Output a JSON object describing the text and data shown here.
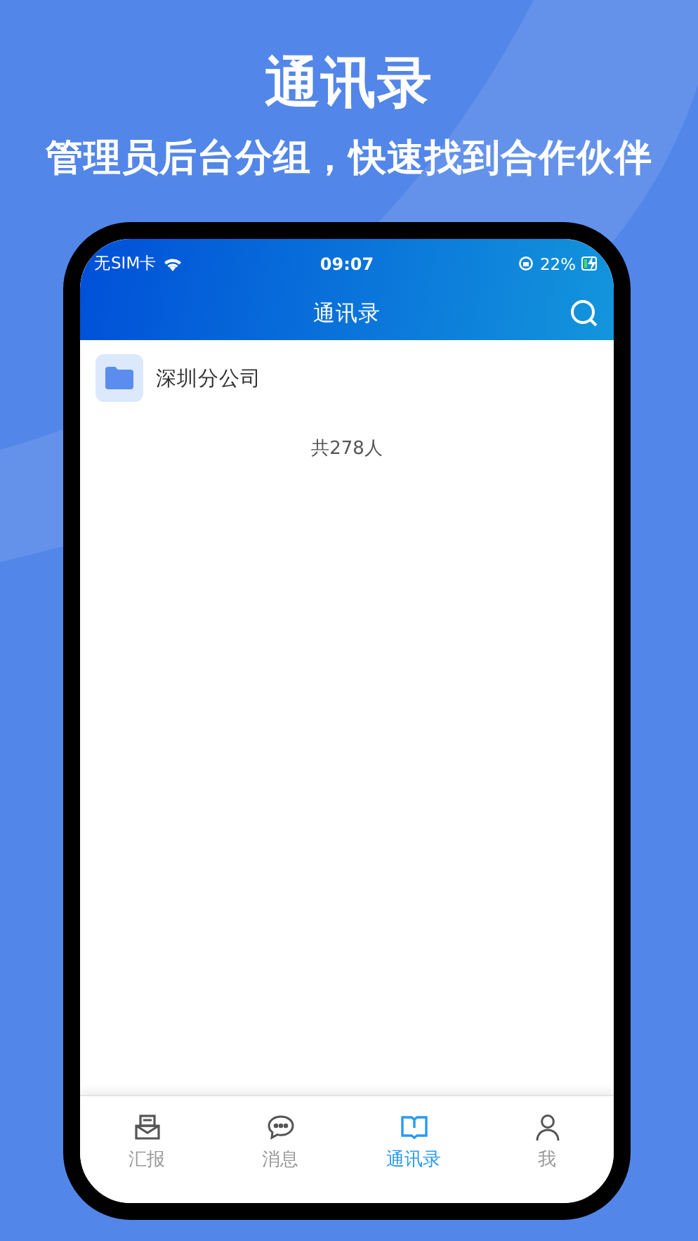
{
  "header": {
    "title": "通讯录",
    "subtitle": "管理员后台分组，快速找到合作伙伴"
  },
  "status_bar": {
    "carrier": "无SIM卡",
    "time": "09:07",
    "battery": "22%",
    "charging": true
  },
  "nav_bar": {
    "title": "通讯录"
  },
  "groups": [
    {
      "name": "深圳分公司"
    }
  ],
  "member_count": "共278人",
  "tab_bar": [
    {
      "kind": "report",
      "label": "汇报",
      "selected": false
    },
    {
      "kind": "message",
      "label": "消息",
      "selected": false
    },
    {
      "kind": "contacts",
      "label": "通讯录",
      "selected": true
    },
    {
      "kind": "profile",
      "label": "我",
      "selected": false
    }
  ]
}
